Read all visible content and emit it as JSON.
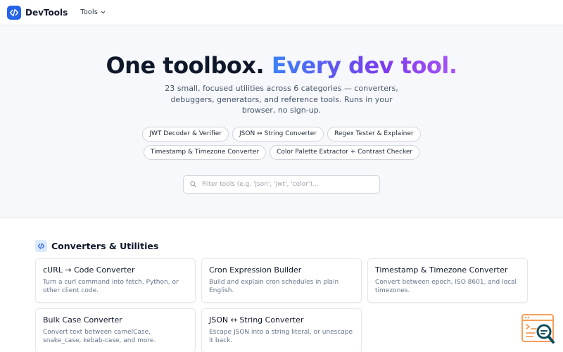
{
  "header": {
    "brand": "DevTools",
    "menu_label": "Tools"
  },
  "hero": {
    "title_plain": "One toolbox.",
    "title_gradient": "Every dev tool.",
    "subtitle": "23 small, focused utilities across 6 categories — converters, debuggers, generators, and reference tools. Runs in your browser, no sign-up.",
    "chips": [
      "JWT Decoder & Verifier",
      "JSON ↔ String Converter",
      "Regex Tester & Explainer",
      "Timestamp & Timezone Converter",
      "Color Palette Extractor + Contrast Checker"
    ],
    "search_placeholder": "Filter tools (e.g. 'json', 'jwt', 'color')..."
  },
  "section": {
    "title": "Converters & Utilities",
    "cards": [
      {
        "title": "cURL → Code Converter",
        "desc": "Turn a curl command into fetch, Python, or other client code."
      },
      {
        "title": "Cron Expression Builder",
        "desc": "Build and explain cron schedules in plain English."
      },
      {
        "title": "Timestamp & Timezone Converter",
        "desc": "Convert between epoch, ISO 8601, and local timezones."
      },
      {
        "title": "Bulk Case Converter",
        "desc": "Convert text between camelCase, snake_case, kebab-case, and more."
      },
      {
        "title": "JSON ↔ String Converter",
        "desc": "Escape JSON into a string literal, or unescape it back."
      }
    ]
  },
  "colors": {
    "accent": "#2563eb",
    "gradient_start": "#3b82f6",
    "gradient_end": "#a855f7",
    "hero_bg": "#f6f8fb",
    "fab_orange": "#f59e5b",
    "fab_teal": "#0f4c5c"
  },
  "icons": {
    "logo": "code-brackets-icon",
    "menu": "chevron-down-icon",
    "search": "search-icon",
    "section": "code-brackets-icon",
    "fab": "code-search-icon"
  }
}
